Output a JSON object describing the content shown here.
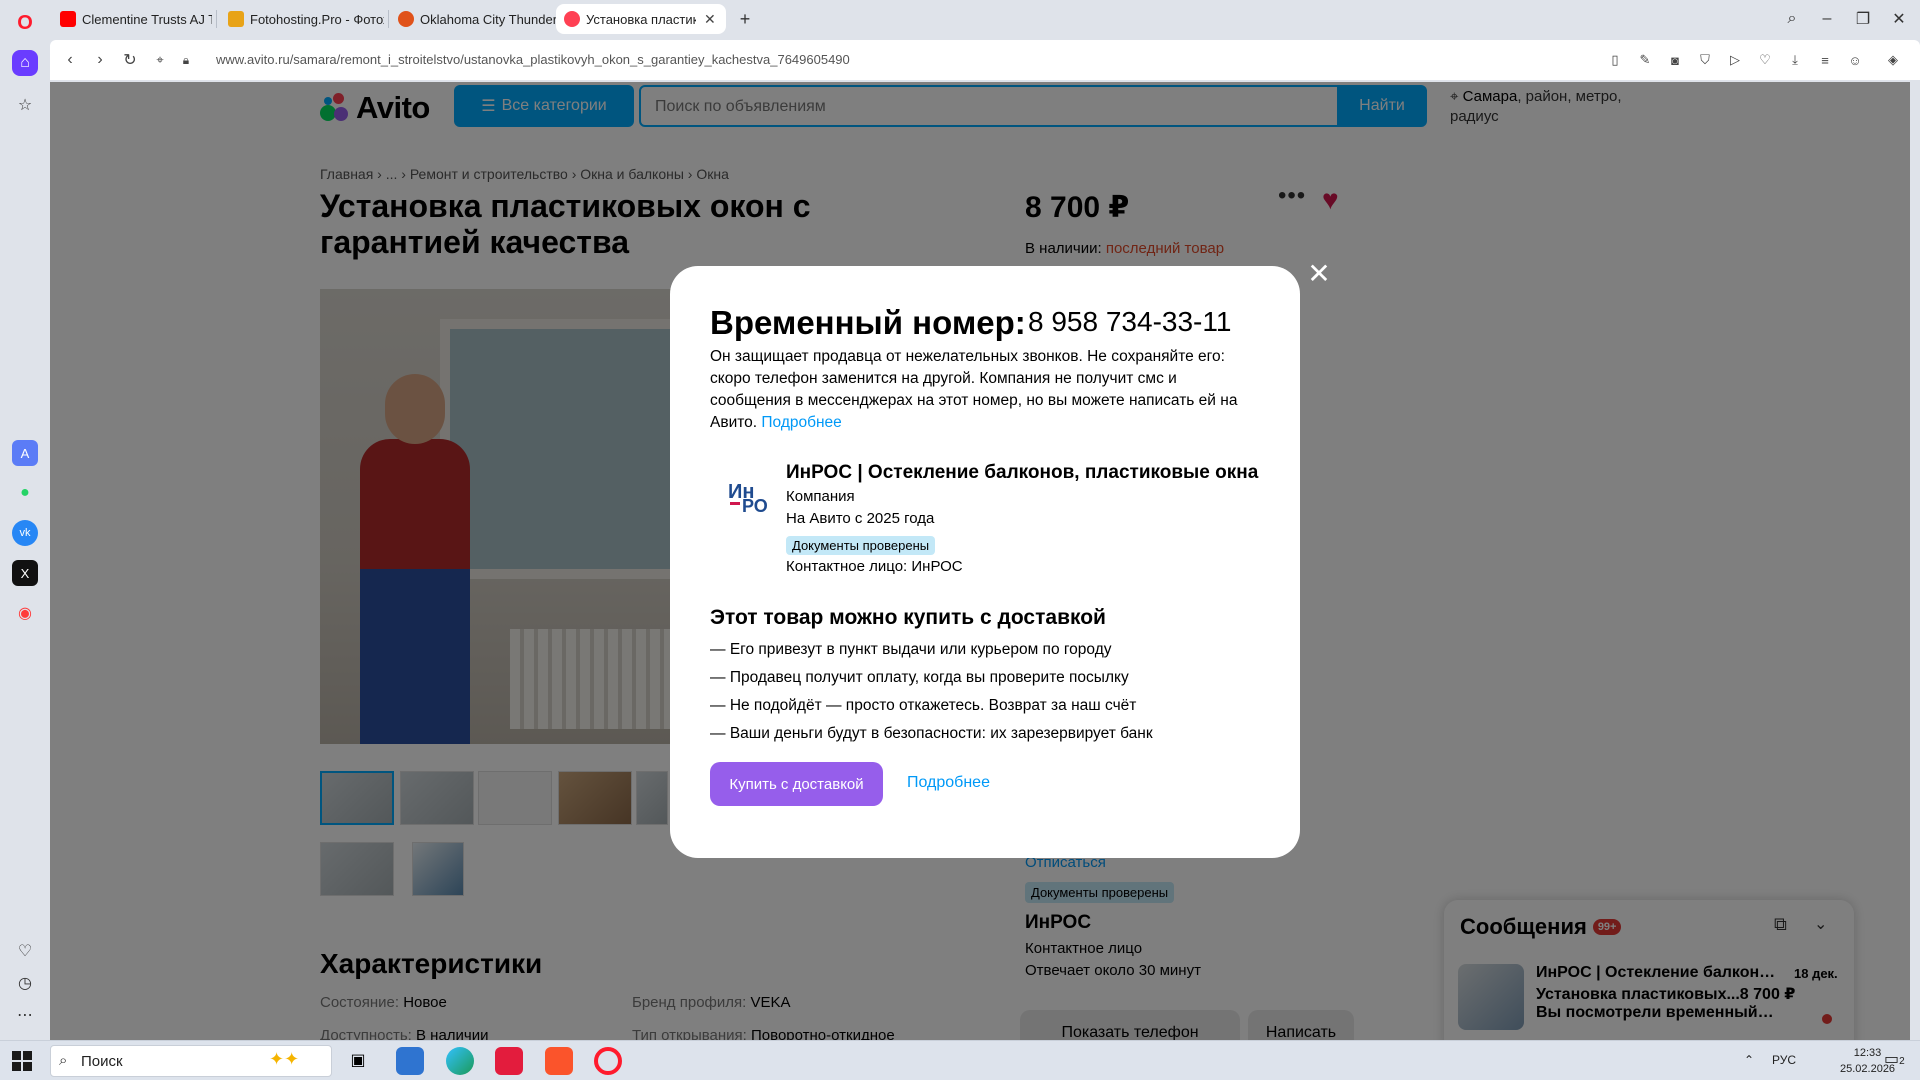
{
  "browser": {
    "tabs": [
      {
        "title": "Clementine Trusts AJ To M",
        "fav_color": "#ff0000"
      },
      {
        "title": "Fotohosting.Pro - Фотохо",
        "fav_color": "#e8a317"
      },
      {
        "title": "Oklahoma City Thunder",
        "fav_color": "#e0521a"
      },
      {
        "title": "Установка пластиковых о",
        "fav_color": "#ff4053"
      }
    ],
    "new_tab": "+",
    "url": "www.avito.ru/samara/remont_i_stroitelstvo/ustanovka_plastikovyh_okon_s_garantiey_kachestva_7649605490"
  },
  "header": {
    "logo_text": "Avito",
    "categories_label": "Все категории",
    "search_placeholder": "Поиск по объявлениям",
    "find_label": "Найти",
    "location_city": "Самара",
    "location_rest": ", район, метро, радиус"
  },
  "breadcrumbs": "Главная › ... › Ремонт и строительство › Окна и балконы › Окна",
  "listing": {
    "title": "Установка пластиковых окон с гарантией качества",
    "price": "8 700 ₽",
    "stock_label": "В наличии:",
    "stock_value": "последний товар",
    "unsubscribe": "Отписаться",
    "docs_badge": "Документы проверены",
    "seller_name": "ИнРОС",
    "contact_label": "Контактное лицо",
    "response_time": "Отвечает около 30 минут",
    "show_phone": "Показать телефон",
    "write": "Написать"
  },
  "characteristics": {
    "title": "Характеристики",
    "rows": [
      {
        "key": "Состояние:",
        "value": "Новое"
      },
      {
        "key": "Бренд профиля:",
        "value": "VEKA"
      },
      {
        "key": "Доступность:",
        "value": "В наличии"
      },
      {
        "key": "Тип открывания:",
        "value": "Поворотно-откидное"
      }
    ]
  },
  "modal": {
    "title": "Временный номер:",
    "phone": "8 958 734-33-11",
    "description": "Он защищает продавца от нежелательных звонков. Не сохраняйте его: скоро телефон заменится на другой. Компания не получит смс и сообщения в мессенджерах на этот номер, но вы можете написать ей на Авито.",
    "description_link": "Подробнее",
    "seller_title": "ИнРОС | Остекление балконов, пластиковые окна",
    "seller_type": "Компания",
    "seller_since": "На Авито с 2025 года",
    "docs_badge": "Документы проверены",
    "contact": "Контактное лицо: ИнРОС",
    "delivery_title": "Этот товар можно купить с доставкой",
    "delivery_items": [
      "Его привезут в пункт выдачи или курьером по городу",
      "Продавец получит оплату, когда вы проверите посылку",
      "Не подойдёт — просто откажетесь. Возврат за наш счёт",
      "Ваши деньги будут в безопасности: их зарезервирует банк"
    ],
    "buy_label": "Купить с доставкой",
    "more_label": "Подробнее"
  },
  "chat": {
    "title": "Сообщения",
    "count": "99+",
    "line1": "ИнРОС | Остекление балконов, пластиковые окна",
    "date": "18 дек.",
    "line2": "Установка пластиковых...8 700 ₽",
    "line3": "Вы посмотрели временный номер"
  },
  "taskbar": {
    "search_label": "Поиск",
    "lang": "РУС",
    "time": "12:33",
    "date": "25.02.2026",
    "notif_count": "2"
  },
  "colors": {
    "avito_blue": "#00aaff",
    "buy_purple": "#965eeb",
    "link_blue": "#0099f7",
    "heart_red": "#d0174e"
  }
}
